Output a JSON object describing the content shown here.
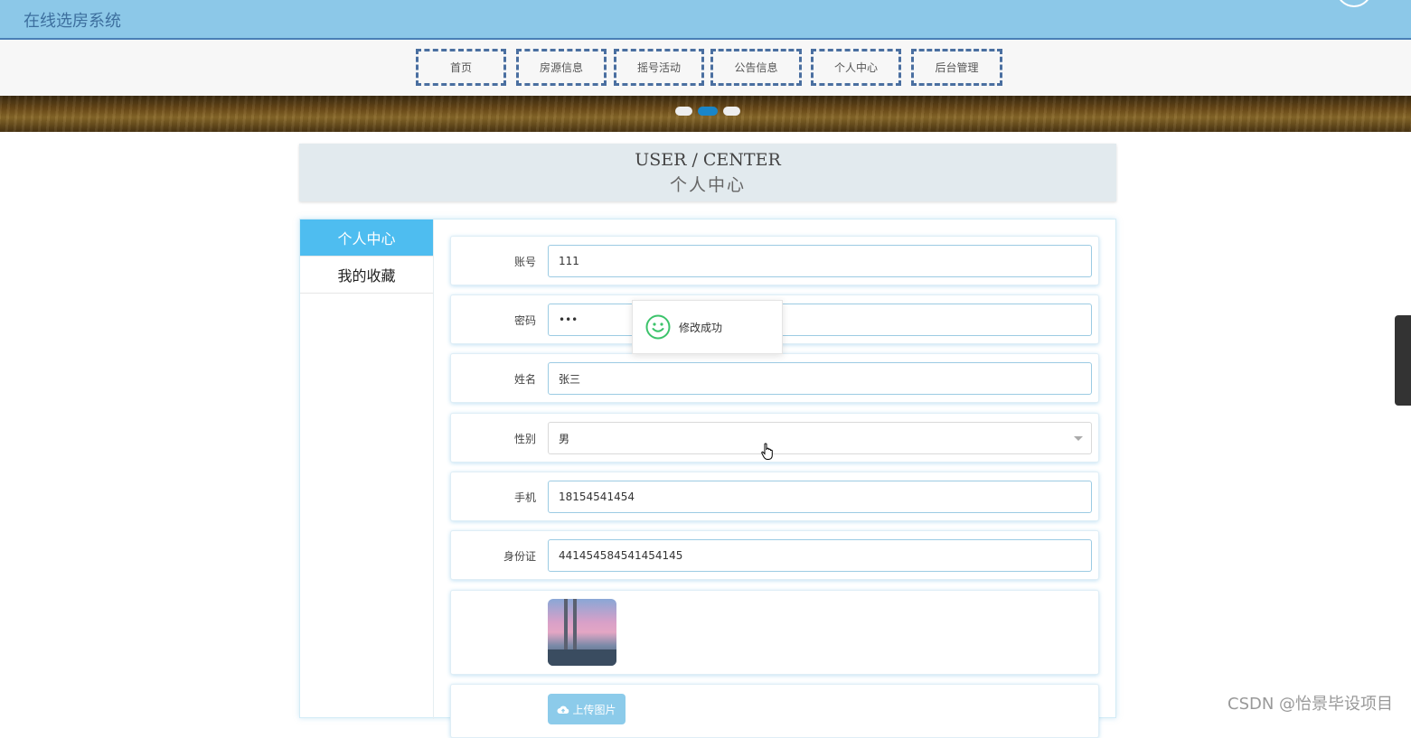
{
  "app": {
    "title": "在线选房系统"
  },
  "nav": {
    "items": [
      {
        "label": "首页"
      },
      {
        "label": "房源信息"
      },
      {
        "label": "摇号活动"
      },
      {
        "label": "公告信息"
      },
      {
        "label": "个人中心"
      },
      {
        "label": "后台管理"
      }
    ]
  },
  "carousel": {
    "slide_count": 3,
    "active_index": 1
  },
  "header": {
    "title_en": "USER / CENTER",
    "title_zh": "个人中心"
  },
  "sidebar": {
    "items": [
      {
        "label": "个人中心",
        "active": true
      },
      {
        "label": "我的收藏",
        "active": false
      }
    ]
  },
  "form": {
    "account": {
      "label": "账号",
      "value": "111"
    },
    "password": {
      "label": "密码",
      "value": "•••"
    },
    "name": {
      "label": "姓名",
      "value": "张三"
    },
    "gender": {
      "label": "性别",
      "value": "男"
    },
    "phone": {
      "label": "手机",
      "value": "18154541454"
    },
    "id_card": {
      "label": "身份证",
      "value": "441454584541454145"
    },
    "upload": {
      "label": "上传图片",
      "icon": "cloud-upload-icon"
    }
  },
  "toast": {
    "text": "修改成功",
    "icon": "smile-icon",
    "color": "#3cc36b"
  },
  "watermark": "CSDN @怡景毕设项目",
  "colors": {
    "topbar": "#8cc8e8",
    "accent": "#4ebdf0",
    "nav_border": "#4a6fa0"
  }
}
